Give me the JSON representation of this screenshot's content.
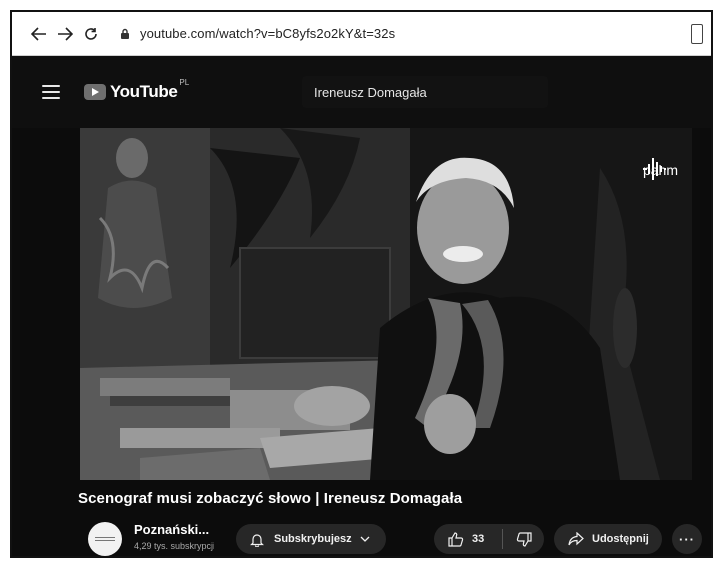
{
  "browser": {
    "url": "youtube.com/watch?v=bC8yfs2o2kY&t=32s",
    "back_icon": "back-arrow-icon",
    "forward_icon": "forward-arrow-icon",
    "reload_icon": "reload-icon"
  },
  "header": {
    "logo_text": "YouTube",
    "logo_region": "PL",
    "search_value": "Ireneusz Domagała"
  },
  "video": {
    "watermark": "pahm",
    "title": "Scenograf musi zobaczyć słowo | Ireneusz Domagała"
  },
  "channel": {
    "name": "Poznański...",
    "subscribers": "4,29 tys. subskrypcji"
  },
  "actions": {
    "subscribe_label": "Subskrybujesz",
    "like_count": "33",
    "share_label": "Udostępnij",
    "more_label": "···"
  },
  "colors": {
    "page_background": "#0f0f0f",
    "pill_background": "#272727",
    "text_primary": "#ffffff",
    "text_secondary": "#aaaaaa"
  }
}
